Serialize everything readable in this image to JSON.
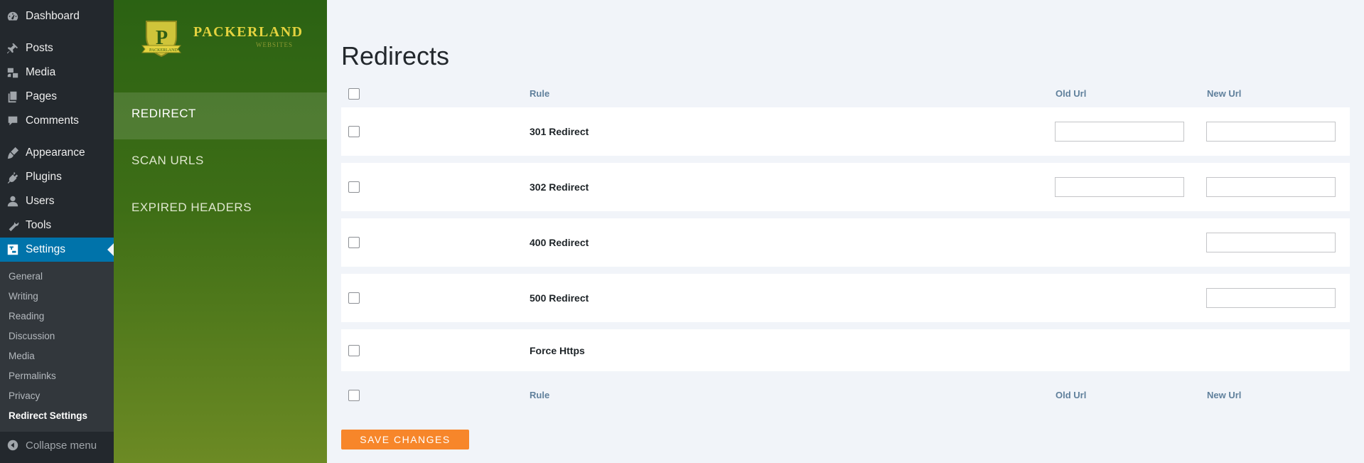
{
  "admin_menu": {
    "items": [
      {
        "label": "Dashboard",
        "icon": "dashboard-icon"
      },
      {
        "label": "Posts",
        "icon": "pin-icon"
      },
      {
        "label": "Media",
        "icon": "media-icon"
      },
      {
        "label": "Pages",
        "icon": "pages-icon"
      },
      {
        "label": "Comments",
        "icon": "comment-icon"
      },
      {
        "label": "Appearance",
        "icon": "brush-icon"
      },
      {
        "label": "Plugins",
        "icon": "plug-icon"
      },
      {
        "label": "Users",
        "icon": "user-icon"
      },
      {
        "label": "Tools",
        "icon": "wrench-icon"
      },
      {
        "label": "Settings",
        "icon": "settings-icon"
      }
    ],
    "submenu": [
      "General",
      "Writing",
      "Reading",
      "Discussion",
      "Media",
      "Permalinks",
      "Privacy",
      "Redirect Settings"
    ],
    "collapse_label": "Collapse menu"
  },
  "plugin": {
    "brand": "PACKERLAND",
    "brand_sub": "WEBSITES",
    "shield_letter": "P",
    "shield_banner": "PACKERLAND",
    "nav": [
      "REDIRECT",
      "SCAN URLS",
      "EXPIRED HEADERS"
    ]
  },
  "main": {
    "title": "Redirects",
    "columns": {
      "rule": "Rule",
      "old_url": "Old Url",
      "new_url": "New Url"
    },
    "rows": [
      {
        "rule": "301 Redirect",
        "old_url": "",
        "new_url": ""
      },
      {
        "rule": "302 Redirect",
        "old_url": "",
        "new_url": ""
      },
      {
        "rule": "400 Redirect",
        "new_url": ""
      },
      {
        "rule": "500 Redirect",
        "new_url": ""
      },
      {
        "rule": "Force Https"
      }
    ],
    "save_label": "SAVE CHANGES"
  },
  "colors": {
    "wp_sidebar": "#23282d",
    "wp_active": "#0073aa",
    "plugin_green_top": "#2b6213",
    "plugin_green_bottom": "#6c8a24",
    "brand_gold": "#e4d33f",
    "save_button": "#f7862a",
    "header_text": "#60809c"
  }
}
